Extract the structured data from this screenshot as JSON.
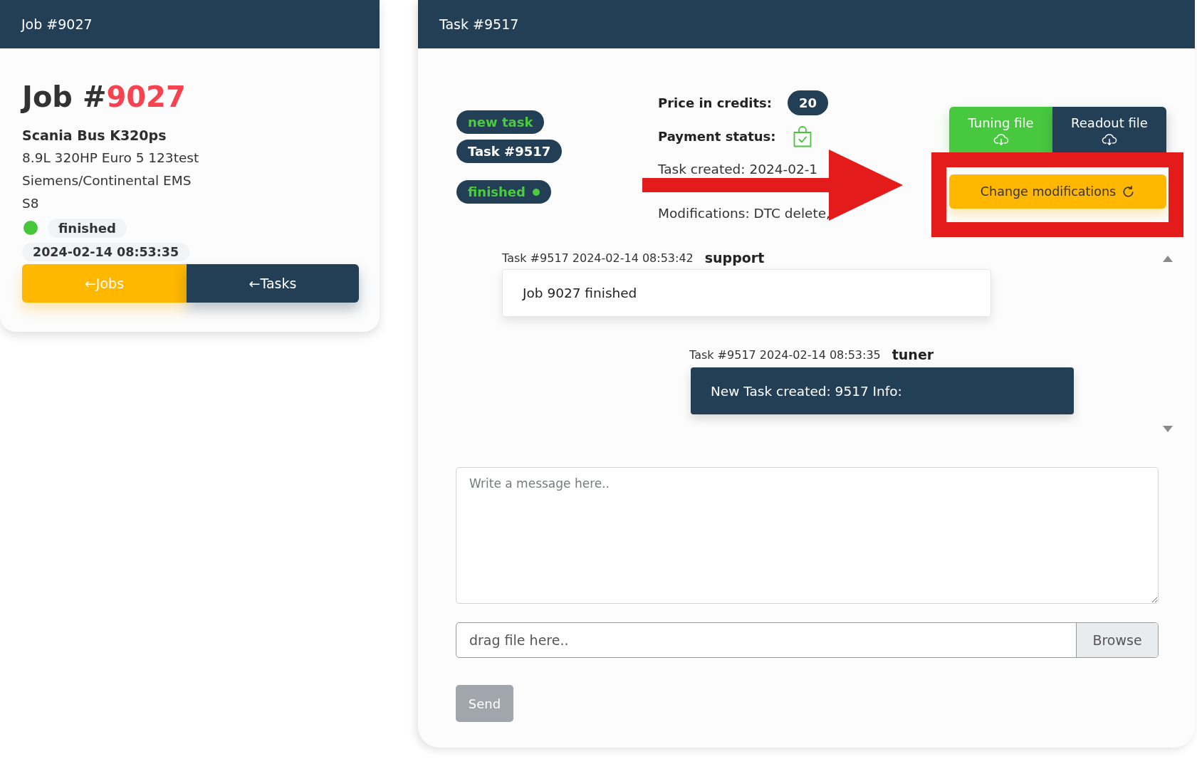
{
  "job_panel": {
    "header": "Job #9027",
    "title_prefix": "Job #",
    "title_number": "9027",
    "vehicle": "Scania Bus K320ps",
    "details": [
      "8.9L 320HP Euro 5 123test",
      "Siemens/Continental EMS",
      "S8"
    ],
    "status": {
      "label": "finished",
      "color": "#46c73b"
    },
    "date": "2024-02-14 08:53:35",
    "buttons": [
      {
        "kind": "jobs",
        "label": "←Jobs"
      },
      {
        "kind": "tasks",
        "label": "←Tasks"
      }
    ]
  },
  "task_panel": {
    "header": "Task #9517",
    "badges": [
      {
        "kind": "tag",
        "label": "new task"
      },
      {
        "kind": "id",
        "label": "Task #9517"
      },
      {
        "kind": "status",
        "label": "finished"
      }
    ],
    "price": {
      "label": "Price in credits:",
      "value": "20"
    },
    "payment": {
      "label": "Payment status:",
      "paid": true
    },
    "task_created": "Task created: 2024-02-1",
    "modifications": "Modifications: DTC delete,",
    "file_buttons": [
      {
        "kind": "tuning",
        "label": "Tuning file"
      },
      {
        "kind": "readout",
        "label": "Readout file"
      }
    ],
    "change_button": "Change modifications",
    "messages": [
      {
        "kind": "incoming",
        "meta": "Task #9517 2024-02-14 08:53:42",
        "author": "support",
        "text": "Job 9027 finished"
      },
      {
        "kind": "outgoing",
        "meta": "Task #9517 2024-02-14 08:53:35",
        "author": "tuner",
        "text": "New Task created: 9517 Info:"
      }
    ],
    "message_field": {
      "placeholder": "Write a message here.."
    },
    "file_field": {
      "label": "drag file here..",
      "button": "Browse"
    },
    "send_button": {
      "label": "Send",
      "disabled": true
    }
  }
}
